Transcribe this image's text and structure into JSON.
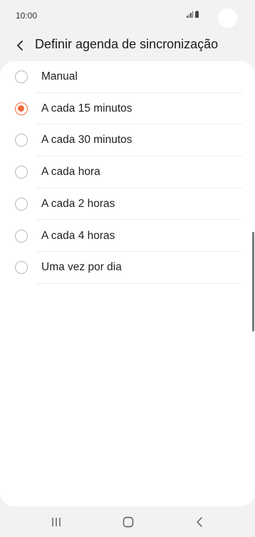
{
  "status_bar": {
    "time": "10:00",
    "icons": [
      "signal-icon",
      "battery-icon"
    ]
  },
  "header": {
    "back_icon": "chevron-left-icon",
    "title": "Definir agenda de sincronização"
  },
  "options": [
    {
      "label": "Manual",
      "checked": false
    },
    {
      "label": "A cada 15 minutos",
      "checked": true
    },
    {
      "label": "A cada 30 minutos",
      "checked": false
    },
    {
      "label": "A cada hora",
      "checked": false
    },
    {
      "label": "A cada 2 horas",
      "checked": false
    },
    {
      "label": "A cada 4 horas",
      "checked": false
    },
    {
      "label": "Uma vez por dia",
      "checked": false
    }
  ],
  "nav_bar": {
    "buttons": [
      "recent-apps-icon",
      "home-icon",
      "back-icon"
    ]
  },
  "colors": {
    "accent": "#f26c3d",
    "background": "#f2f2f2",
    "card": "#ffffff"
  }
}
